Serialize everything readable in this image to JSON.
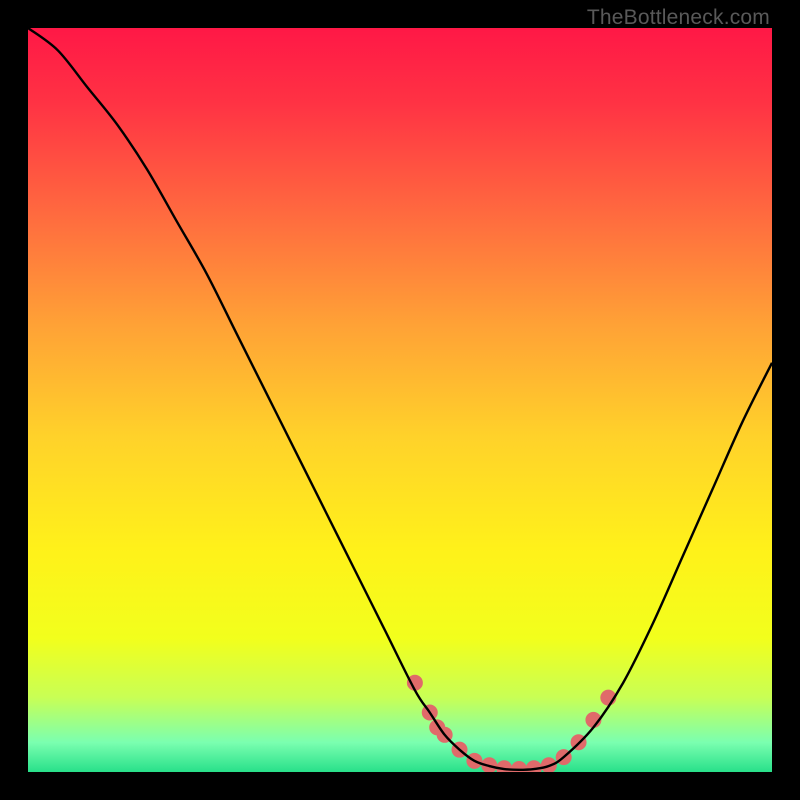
{
  "watermark": "TheBottleneck.com",
  "chart_data": {
    "type": "line",
    "title": "",
    "xlabel": "",
    "ylabel": "",
    "xlim": [
      0,
      100
    ],
    "ylim": [
      0,
      100
    ],
    "grid": false,
    "legend": false,
    "background_gradient": {
      "stops": [
        {
          "offset": 0.0,
          "color": "#ff1846"
        },
        {
          "offset": 0.1,
          "color": "#ff3244"
        },
        {
          "offset": 0.25,
          "color": "#ff6a3f"
        },
        {
          "offset": 0.4,
          "color": "#ffa236"
        },
        {
          "offset": 0.55,
          "color": "#ffd22a"
        },
        {
          "offset": 0.7,
          "color": "#fff11a"
        },
        {
          "offset": 0.82,
          "color": "#f2ff1c"
        },
        {
          "offset": 0.9,
          "color": "#c8ff55"
        },
        {
          "offset": 0.96,
          "color": "#7bffb0"
        },
        {
          "offset": 1.0,
          "color": "#28e08a"
        }
      ]
    },
    "series": [
      {
        "name": "bottleneck-curve",
        "color": "#000000",
        "x": [
          0,
          4,
          8,
          12,
          16,
          20,
          24,
          28,
          32,
          36,
          40,
          44,
          48,
          52,
          54,
          56,
          58,
          60,
          62,
          64,
          66,
          68,
          70,
          72,
          76,
          80,
          84,
          88,
          92,
          96,
          100
        ],
        "y": [
          100,
          97,
          92,
          87,
          81,
          74,
          67,
          59,
          51,
          43,
          35,
          27,
          19,
          11,
          8,
          5,
          3,
          1.5,
          0.8,
          0.4,
          0.3,
          0.4,
          0.8,
          2,
          6,
          12,
          20,
          29,
          38,
          47,
          55
        ]
      }
    ],
    "markers": {
      "name": "highlight-dots",
      "color": "#e06a6a",
      "radius": 8,
      "x": [
        52,
        54,
        55,
        56,
        58,
        60,
        62,
        64,
        66,
        68,
        70,
        72,
        74,
        76,
        78
      ],
      "y": [
        12,
        8,
        6,
        5,
        3,
        1.5,
        0.9,
        0.5,
        0.4,
        0.5,
        0.9,
        2,
        4,
        7,
        10
      ]
    }
  }
}
